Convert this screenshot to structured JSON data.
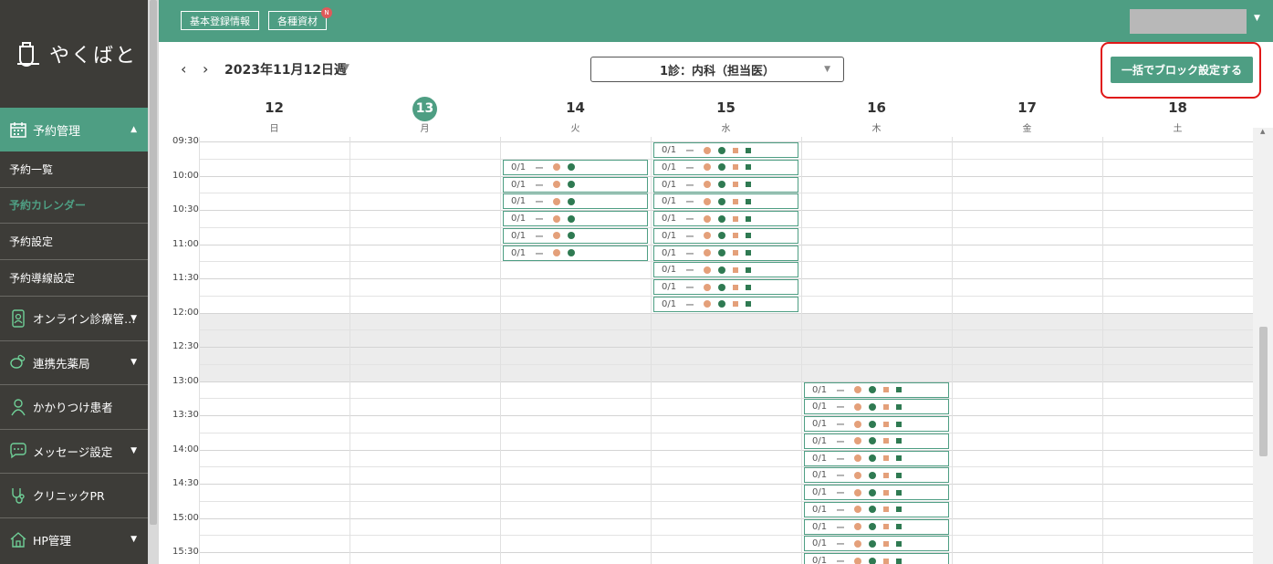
{
  "sidebar": {
    "logo_text": "やくばと",
    "active": {
      "label": "予約管理"
    },
    "submenu": [
      {
        "label": "予約一覧",
        "current": false
      },
      {
        "label": "予約カレンダー",
        "current": true
      },
      {
        "label": "予約設定",
        "current": false
      },
      {
        "label": "予約導線設定",
        "current": false
      }
    ],
    "items": [
      {
        "label": "オンライン診療管…",
        "icon": "phone-person-icon",
        "caret": true
      },
      {
        "label": "連携先薬局",
        "icon": "pill-icon",
        "caret": true
      },
      {
        "label": "かかりつけ患者",
        "icon": "person-icon",
        "caret": false
      },
      {
        "label": "メッセージ設定",
        "icon": "chat-bubble-icon",
        "caret": true
      },
      {
        "label": "クリニックPR",
        "icon": "stethoscope-icon",
        "caret": false
      },
      {
        "label": "HP管理",
        "icon": "home-icon",
        "caret": true
      }
    ]
  },
  "topbar": {
    "basic_info": "基本登録情報",
    "materials": "各種資材",
    "materials_badge": "N"
  },
  "header": {
    "prev": "‹",
    "next": "›",
    "week": "2023年11月12日週",
    "clinic": "1診：内科（担当医）",
    "block_button": "一括でブロック設定する"
  },
  "days": [
    {
      "num": "12",
      "dow": "日",
      "today": false
    },
    {
      "num": "13",
      "dow": "月",
      "today": true
    },
    {
      "num": "14",
      "dow": "火",
      "today": false
    },
    {
      "num": "15",
      "dow": "水",
      "today": false
    },
    {
      "num": "16",
      "dow": "木",
      "today": false
    },
    {
      "num": "17",
      "dow": "金",
      "today": false
    },
    {
      "num": "18",
      "dow": "土",
      "today": false
    }
  ],
  "times": [
    "09:30",
    "10:00",
    "10:30",
    "11:00",
    "11:30",
    "12:00",
    "12:30",
    "13:00",
    "13:30",
    "14:00",
    "14:30",
    "15:00",
    "15:30"
  ],
  "slot_label": "0/1",
  "slot_dash": "ー",
  "slots": {
    "tue": {
      "day": "14",
      "start": "09:45",
      "count": 6,
      "icons": [
        "orange-dot",
        "green-dot"
      ]
    },
    "wed": {
      "day": "15",
      "start": "09:30",
      "count": 10,
      "icons": [
        "orange-dot",
        "green-dot",
        "orange-camera",
        "green-camera"
      ]
    },
    "thu": {
      "day": "16",
      "start": "13:00",
      "count": 11,
      "icons": [
        "orange-dot",
        "green-dot",
        "orange-camera",
        "green-camera"
      ]
    }
  },
  "colors": {
    "accent": "#4e9e83",
    "sidebar": "#3d3c38",
    "highlight": "#e01818"
  }
}
